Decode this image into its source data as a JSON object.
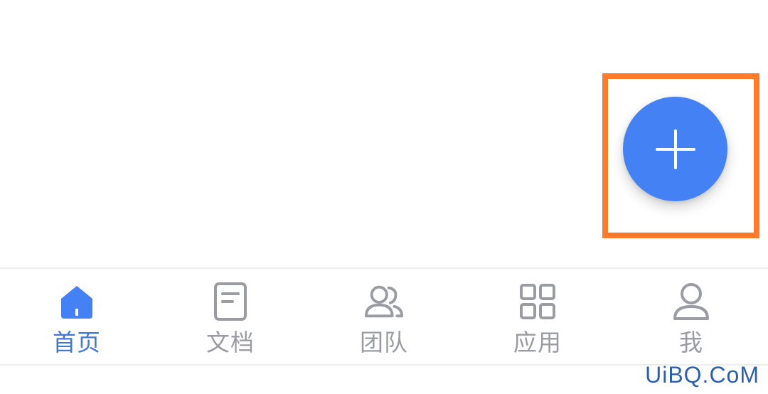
{
  "fab": {
    "icon": "plus-icon",
    "color": "#4381F5"
  },
  "highlight": {
    "color": "#FF7A2A"
  },
  "tabs": [
    {
      "label": "首页",
      "icon": "home-icon",
      "active": true
    },
    {
      "label": "文档",
      "icon": "document-icon",
      "active": false
    },
    {
      "label": "团队",
      "icon": "team-icon",
      "active": false
    },
    {
      "label": "应用",
      "icon": "apps-grid-icon",
      "active": false
    },
    {
      "label": "我",
      "icon": "user-icon",
      "active": false
    }
  ],
  "colors": {
    "active": "#3F79DA",
    "inactive": "#9A9BA3"
  },
  "watermark": "UiBQ.CoM"
}
